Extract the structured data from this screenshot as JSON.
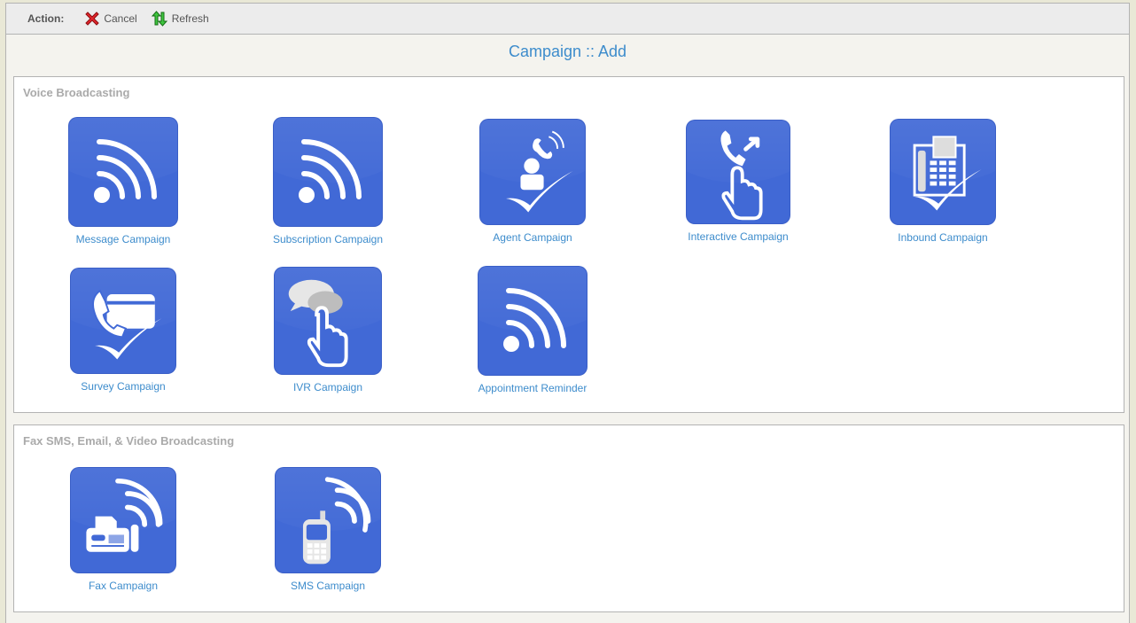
{
  "toolbar": {
    "action_label": "Action:",
    "cancel_label": "Cancel",
    "refresh_label": "Refresh",
    "cancel_icon": "red-x-icon",
    "refresh_icon": "green-refresh-arrows-icon"
  },
  "page_title": "Campaign :: Add",
  "colors": {
    "tile_blue": "#4169d6",
    "link_blue": "#3d8ccc",
    "section_heading": "#aaaaaa"
  },
  "sections": [
    {
      "title": "Voice Broadcasting",
      "tiles": [
        {
          "label": "Message Campaign",
          "icon": "broadcast-waves-icon"
        },
        {
          "label": "Subscription Campaign",
          "icon": "broadcast-waves-icon"
        },
        {
          "label": "Agent Campaign",
          "icon": "agent-phone-check-icon"
        },
        {
          "label": "Interactive Campaign",
          "icon": "phone-hand-pointer-icon"
        },
        {
          "label": "Inbound Campaign",
          "icon": "desk-phone-check-icon"
        },
        {
          "label": "Survey Campaign",
          "icon": "phone-card-check-icon"
        },
        {
          "label": "IVR Campaign",
          "icon": "chat-bubbles-hand-icon"
        },
        {
          "label": "Appointment Reminder",
          "icon": "broadcast-waves-icon"
        }
      ]
    },
    {
      "title": "Fax SMS, Email, & Video Broadcasting",
      "tiles": [
        {
          "label": "Fax Campaign",
          "icon": "fax-waves-icon"
        },
        {
          "label": "SMS Campaign",
          "icon": "mobile-phone-waves-icon"
        }
      ]
    }
  ]
}
